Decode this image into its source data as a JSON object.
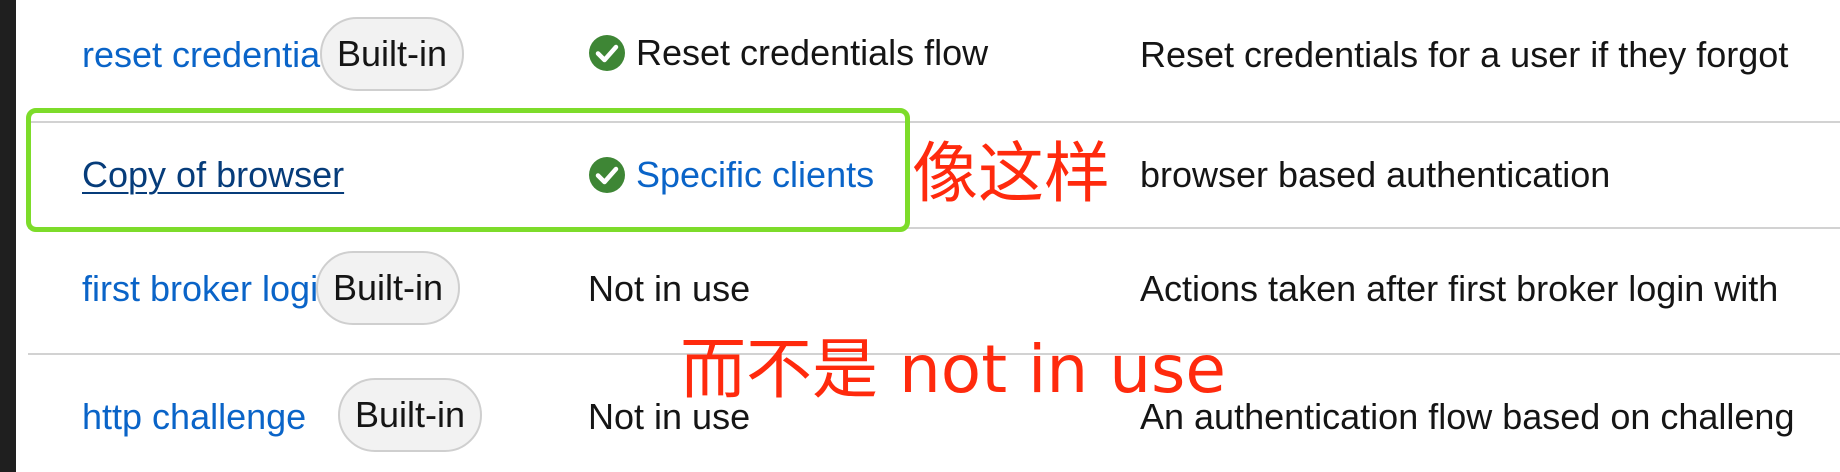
{
  "rows": [
    {
      "name": "reset credentials",
      "badge": "Built-in",
      "used_by": "Reset credentials flow",
      "used_by_icon": "check-circle-icon",
      "description": "Reset credentials for a user if they forgot"
    },
    {
      "name": "Copy of browser",
      "badge": "",
      "used_by": "Specific clients",
      "used_by_icon": "check-circle-icon",
      "description": "browser based authentication"
    },
    {
      "name": "first broker login",
      "badge": "Built-in",
      "used_by": "Not in use",
      "description": "Actions taken after first broker login with"
    },
    {
      "name": "http challenge",
      "badge": "Built-in",
      "used_by": "Not in use",
      "description": "An authentication flow based on challeng"
    }
  ],
  "annotations": {
    "like_this": "像这样",
    "not_not_in_use": "而不是 not in use"
  },
  "colors": {
    "link": "#0a64c8",
    "link_visited": "#063c7a",
    "check_green": "#3e8635",
    "highlight_box": "#7ddc2a",
    "annotation_red": "#ff2a0d"
  }
}
